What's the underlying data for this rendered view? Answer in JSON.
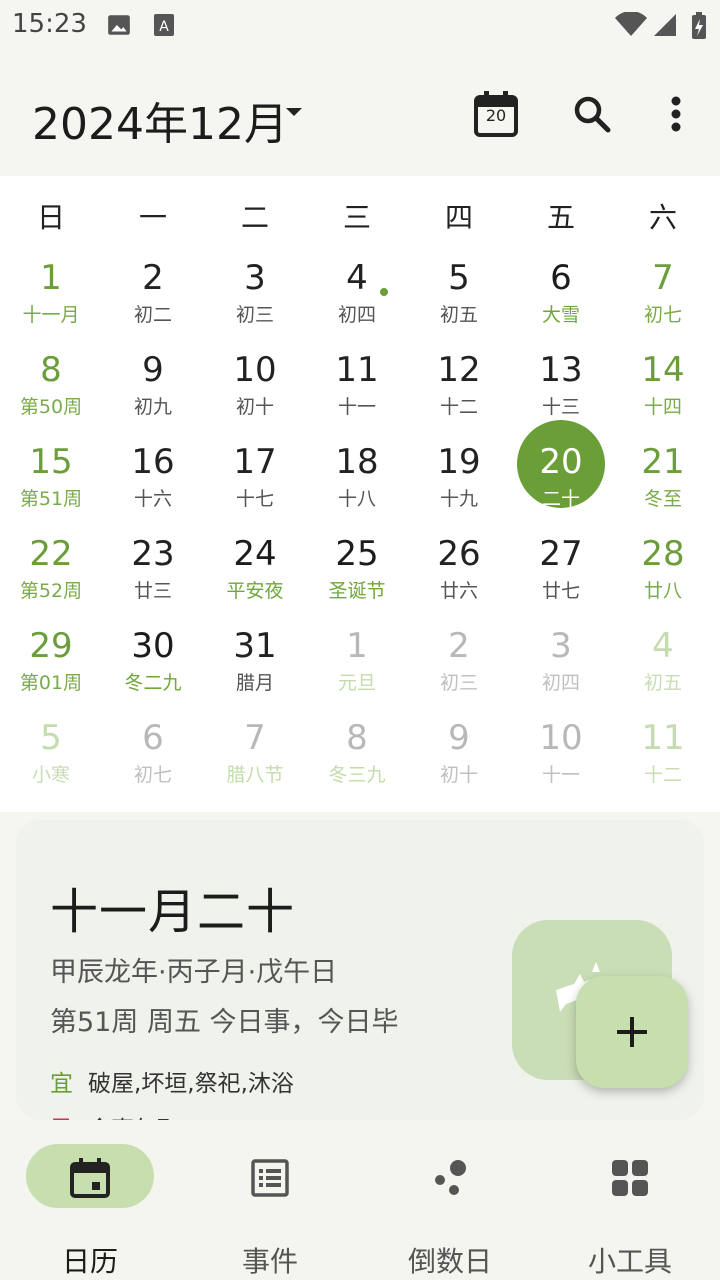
{
  "status_bar": {
    "time": "15:23"
  },
  "header": {
    "month_title": "2024年12月",
    "today_number": "20"
  },
  "colors": {
    "accent": "#6a9f38",
    "accent_light": "#c7dfae",
    "background": "#f5f6f1"
  },
  "calendar": {
    "weekdays": [
      "日",
      "一",
      "二",
      "三",
      "四",
      "五",
      "六"
    ],
    "weeks": [
      [
        {
          "day": "1",
          "sub": "十一月",
          "style": "weekend"
        },
        {
          "day": "2",
          "sub": "初二",
          "style": "dark"
        },
        {
          "day": "3",
          "sub": "初三",
          "style": "dark"
        },
        {
          "day": "4",
          "sub": "初四",
          "style": "dark",
          "dot": true
        },
        {
          "day": "5",
          "sub": "初五",
          "style": "dark"
        },
        {
          "day": "6",
          "sub": "大雪",
          "style": "holiday"
        },
        {
          "day": "7",
          "sub": "初七",
          "style": "weekend"
        }
      ],
      [
        {
          "day": "8",
          "sub": "第50周",
          "style": "weekend"
        },
        {
          "day": "9",
          "sub": "初九",
          "style": "dark"
        },
        {
          "day": "10",
          "sub": "初十",
          "style": "dark"
        },
        {
          "day": "11",
          "sub": "十一",
          "style": "dark"
        },
        {
          "day": "12",
          "sub": "十二",
          "style": "dark"
        },
        {
          "day": "13",
          "sub": "十三",
          "style": "dark"
        },
        {
          "day": "14",
          "sub": "十四",
          "style": "weekend"
        }
      ],
      [
        {
          "day": "15",
          "sub": "第51周",
          "style": "weekend"
        },
        {
          "day": "16",
          "sub": "十六",
          "style": "dark"
        },
        {
          "day": "17",
          "sub": "十七",
          "style": "dark"
        },
        {
          "day": "18",
          "sub": "十八",
          "style": "dark"
        },
        {
          "day": "19",
          "sub": "十九",
          "style": "dark"
        },
        {
          "day": "20",
          "sub": "二十",
          "style": "selected"
        },
        {
          "day": "21",
          "sub": "冬至",
          "style": "weekend"
        }
      ],
      [
        {
          "day": "22",
          "sub": "第52周",
          "style": "weekend"
        },
        {
          "day": "23",
          "sub": "廿三",
          "style": "dark"
        },
        {
          "day": "24",
          "sub": "平安夜",
          "style": "holiday"
        },
        {
          "day": "25",
          "sub": "圣诞节",
          "style": "holiday"
        },
        {
          "day": "26",
          "sub": "廿六",
          "style": "dark"
        },
        {
          "day": "27",
          "sub": "廿七",
          "style": "dark"
        },
        {
          "day": "28",
          "sub": "廿八",
          "style": "weekend"
        }
      ],
      [
        {
          "day": "29",
          "sub": "第01周",
          "style": "weekend"
        },
        {
          "day": "30",
          "sub": "冬二九",
          "style": "holiday"
        },
        {
          "day": "31",
          "sub": "腊月",
          "style": "dark"
        },
        {
          "day": "1",
          "sub": "元旦",
          "style": "gray-holiday"
        },
        {
          "day": "2",
          "sub": "初三",
          "style": "gray"
        },
        {
          "day": "3",
          "sub": "初四",
          "style": "gray"
        },
        {
          "day": "4",
          "sub": "初五",
          "style": "gray-weekend"
        }
      ],
      [
        {
          "day": "5",
          "sub": "小寒",
          "style": "gray-weekend"
        },
        {
          "day": "6",
          "sub": "初七",
          "style": "gray"
        },
        {
          "day": "7",
          "sub": "腊八节",
          "style": "gray-holiday"
        },
        {
          "day": "8",
          "sub": "冬三九",
          "style": "gray-holiday"
        },
        {
          "day": "9",
          "sub": "初十",
          "style": "gray"
        },
        {
          "day": "10",
          "sub": "十一",
          "style": "gray"
        },
        {
          "day": "11",
          "sub": "十二",
          "style": "gray-weekend"
        }
      ]
    ]
  },
  "detail": {
    "lunar_date": "十一月二十",
    "ganzhi": "甲辰龙年·丙子月·戊午日",
    "week_info": "第51周 周五 今日事，今日毕",
    "yi_label": "宜",
    "yi_text": "破屋,坏垣,祭祀,沐浴",
    "ji_label": "忌",
    "ji_text": "余事勿取"
  },
  "bottom_nav": [
    {
      "label": "日历",
      "icon": "calendar-icon",
      "active": true
    },
    {
      "label": "事件",
      "icon": "list-icon",
      "active": false
    },
    {
      "label": "倒数日",
      "icon": "dots-icon",
      "active": false
    },
    {
      "label": "小工具",
      "icon": "grid-icon",
      "active": false
    }
  ]
}
